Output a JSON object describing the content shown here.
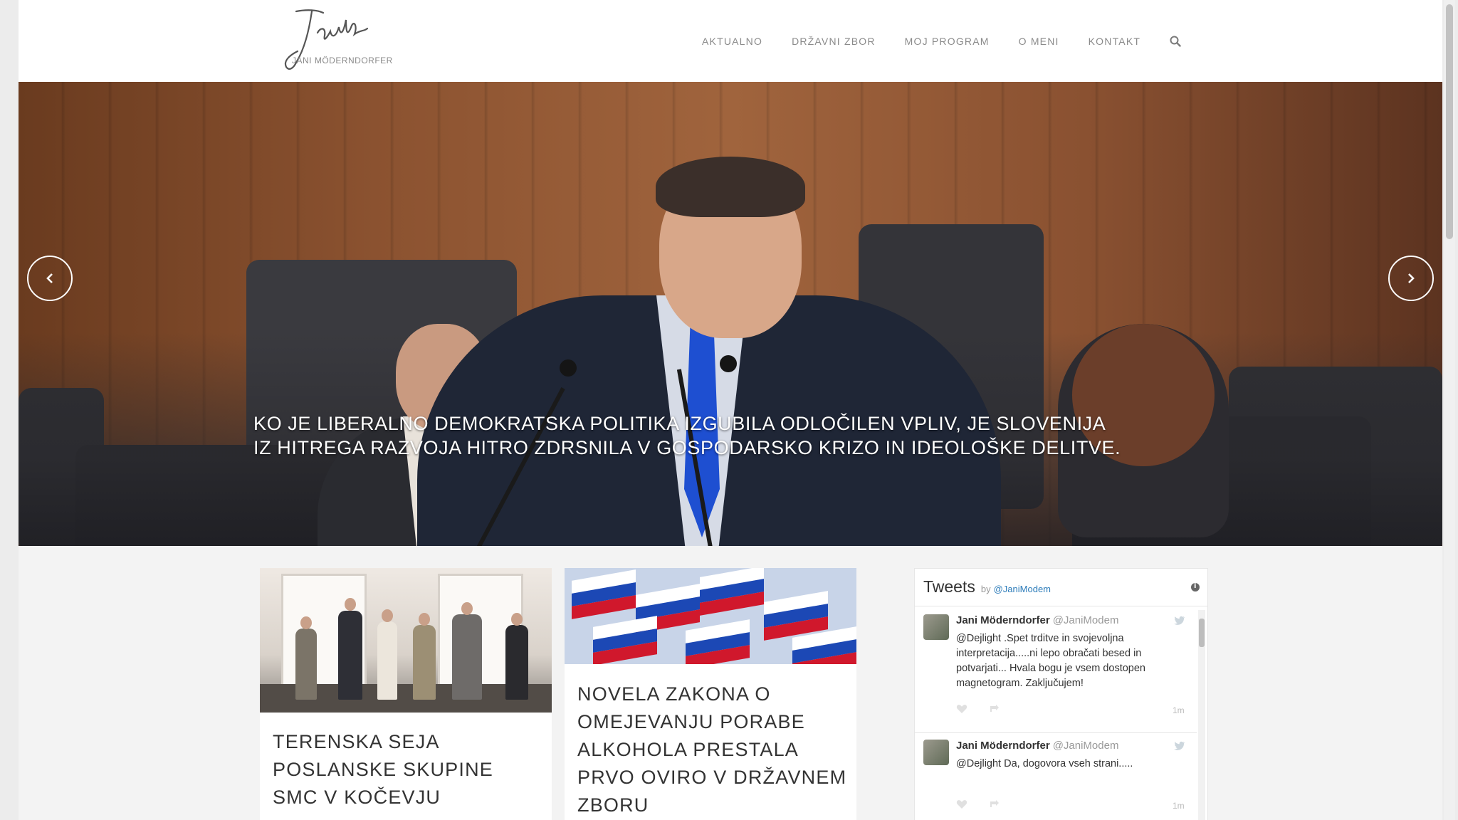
{
  "header": {
    "logo_text": "Jani Möderndorfer",
    "nav": [
      {
        "label": "AKTUALNO"
      },
      {
        "label": "DRŽAVNI ZBOR"
      },
      {
        "label": "MOJ PROGRAM"
      },
      {
        "label": "O MENI"
      },
      {
        "label": "KONTAKT"
      }
    ],
    "search_icon": "search-icon"
  },
  "hero": {
    "caption_line1": "KO JE LIBERALNO DEMOKRATSKA POLITIKA IZGUBILA ODLOČILEN VPLIV, JE SLOVENIJA",
    "caption_line2": "IZ HITREGA RAZVOJA HITRO ZDRSNILA V GOSPODARSKO KRIZO IN IDEOLOŠKE DELITVE.",
    "prev_icon": "chevron-left-icon",
    "next_icon": "chevron-right-icon"
  },
  "posts": [
    {
      "title": "TERENSKA SEJA POSLANSKE SKUPINE SMC V KOČEVJU"
    },
    {
      "title": "NOVELA ZAKONA O OMEJEVANJU PORABE ALKOHOLA PRESTALA PRVO OVIRO V DRŽAVNEM ZBORU"
    }
  ],
  "tweets_widget": {
    "title": "Tweets",
    "by": "by",
    "handle": "@JaniModem",
    "tweets": [
      {
        "name": "Jani Möderndorfer",
        "handle": "@JaniModem",
        "text": "@Dejlight .Spet trditve in svojevoljna interpretacija.....ni lepo obračati besed in potvarjati... Hvala bogu je vsem dostopen magnetogram. Zaključujem!",
        "time": "1m"
      },
      {
        "name": "Jani Möderndorfer",
        "handle": "@JaniModem",
        "text": "@Dejlight Da, dogovora vseh strani.....",
        "time": "1m"
      }
    ]
  },
  "colors": {
    "nav_text": "#8a8a8a",
    "title_text": "#333333",
    "twitter_link": "#2b7bb9",
    "tie_blue": "#1e4fd1"
  }
}
